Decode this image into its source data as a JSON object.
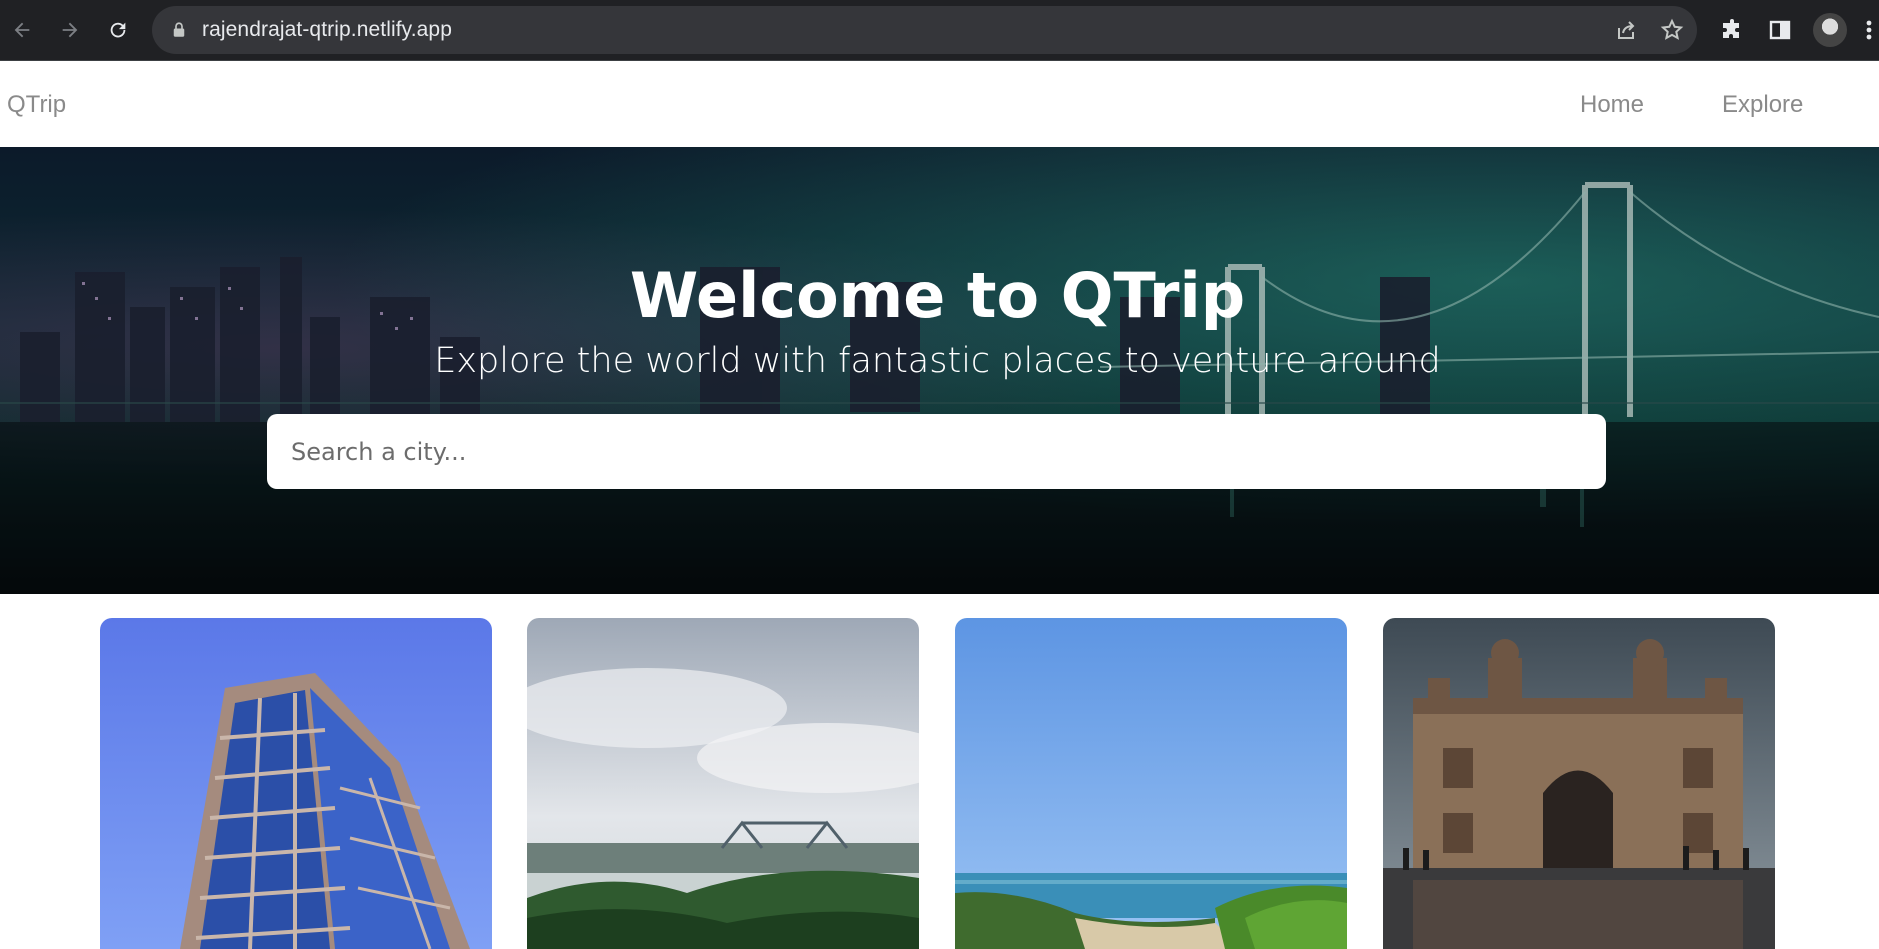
{
  "browser": {
    "url": "rajendrajat-qtrip.netlify.app",
    "icons": [
      "back-arrow-icon",
      "forward-arrow-icon",
      "reload-icon",
      "lock-icon",
      "share-icon",
      "star-icon",
      "extensions-icon",
      "side-panel-icon",
      "profile-avatar",
      "more-menu-icon"
    ]
  },
  "navbar": {
    "brand": "QTrip",
    "links": [
      "Home",
      "Explore"
    ]
  },
  "hero": {
    "title": "Welcome to QTrip",
    "subtitle": "Explore the world with fantastic places to venture around",
    "search_placeholder": "Search a city..."
  },
  "cards": [
    {
      "image": "glass-skyscraper-photo"
    },
    {
      "image": "river-bridge-photo"
    },
    {
      "image": "beach-coast-photo"
    },
    {
      "image": "gateway-monument-photo"
    }
  ],
  "colors": {
    "chrome_bg": "#202124",
    "omnibox_bg": "#35363a",
    "nav_text": "#8a8a8a",
    "hero_text": "#ffffff"
  }
}
